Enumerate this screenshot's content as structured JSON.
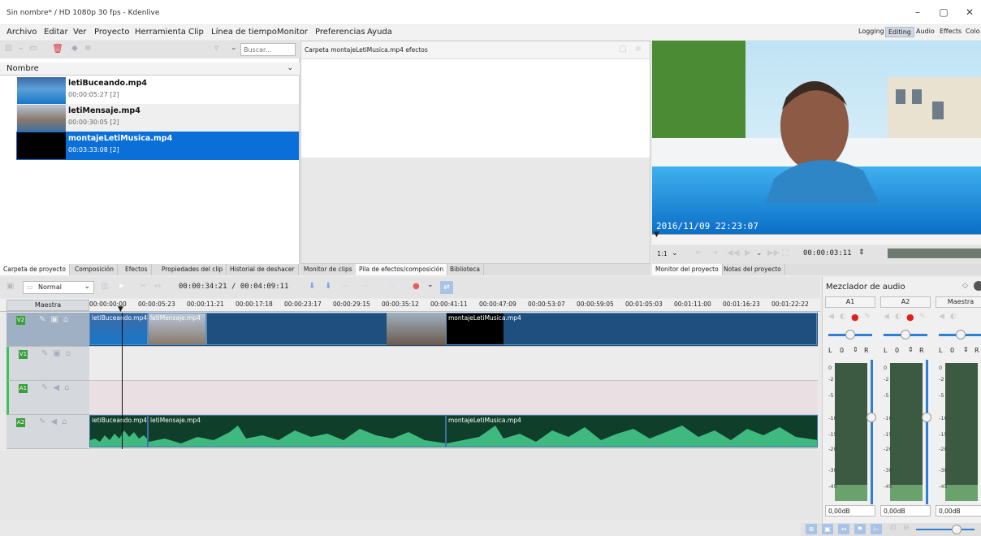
{
  "window": {
    "title": "Sin nombre* / HD 1080p 30 fps - Kdenlive",
    "minimize": "–",
    "maximize": "▢",
    "close": "✕"
  },
  "menu": [
    "Archivo",
    "Editar",
    "Ver",
    "Proyecto",
    "Herramienta",
    "Clip",
    "Línea de tiempo",
    "Monitor",
    "Preferencias",
    "Ayuda"
  ],
  "layouts": [
    "Logging",
    "Editing",
    "Audio",
    "Effects",
    "Colo"
  ],
  "project_bin": {
    "search_placeholder": "Buscar...",
    "column_header": "Nombre",
    "clips": [
      {
        "name": "letiBuceando.mp4",
        "duration": "00:00:05:27 [2]"
      },
      {
        "name": "letiMensaje.mp4",
        "duration": "00:00:30:05 [2]"
      },
      {
        "name": "montajeLetiMusica.mp4",
        "duration": "00:03:33:08 [2]"
      }
    ],
    "tabs": [
      "Carpeta de proyecto",
      "Composición",
      "Efectos",
      "Propiedades del clip",
      "Historial de deshacer"
    ]
  },
  "effects_panel": {
    "title": "Carpeta montajeLetiMusica.mp4 efectos",
    "tabs": [
      "Monitor de clips",
      "Pila de efectos/composición",
      "Biblioteca"
    ]
  },
  "monitor": {
    "overlay_timestamp": "2016/11/09 22:23:07",
    "zoom": "1:1",
    "timecode": "00:00:03:11",
    "tabs": [
      "Monitor del proyecto",
      "Notas del proyecto"
    ]
  },
  "timeline": {
    "mode": "Normal",
    "position": "00:00:34:21 / 00:04:09:11",
    "master_label": "Maestra",
    "ruler": [
      "00:00:00:00",
      "00:00:05:23",
      "00:00:11:21",
      "00:00:17:18",
      "00:00:23:17",
      "00:00:29:15",
      "00:00:35:12",
      "00:00:41:11",
      "00:00:47:09",
      "00:00:53:07",
      "00:00:59:05",
      "00:01:05:03",
      "00:01:11:00",
      "00:01:16:23",
      "00:01:22:22"
    ],
    "tracks": [
      "V2",
      "V1",
      "A1",
      "A2"
    ],
    "video_clips": [
      "letiBuceando.mp4",
      "letiMensaje.mp4",
      "montajeLetiMusica.mp4"
    ],
    "audio_clips": [
      "letiBuceando.mp4",
      "letiMensaje.mp4",
      "montajeLetiMusica.mp4"
    ]
  },
  "mixer": {
    "title": "Mezclador de audio",
    "channels": [
      {
        "name": "A1",
        "left": "L",
        "pan": "0",
        "right": "R",
        "gain": "0,00dB"
      },
      {
        "name": "A2",
        "left": "L",
        "pan": "0",
        "right": "R",
        "gain": "0,00dB"
      },
      {
        "name": "Maestra",
        "left": "L",
        "pan": "0",
        "right": "R",
        "gain": "0,00dB"
      }
    ],
    "db_scale": [
      "0",
      "-2",
      "-5",
      "-10",
      "-15",
      "-20",
      "-30",
      "-45"
    ]
  },
  "colors": {
    "accent": "#0a6fd8",
    "video_clip": "#1f4f7f",
    "audio_wave": "#3fb97f",
    "record": "#e02020",
    "track_badge": "#3b9e3b"
  }
}
